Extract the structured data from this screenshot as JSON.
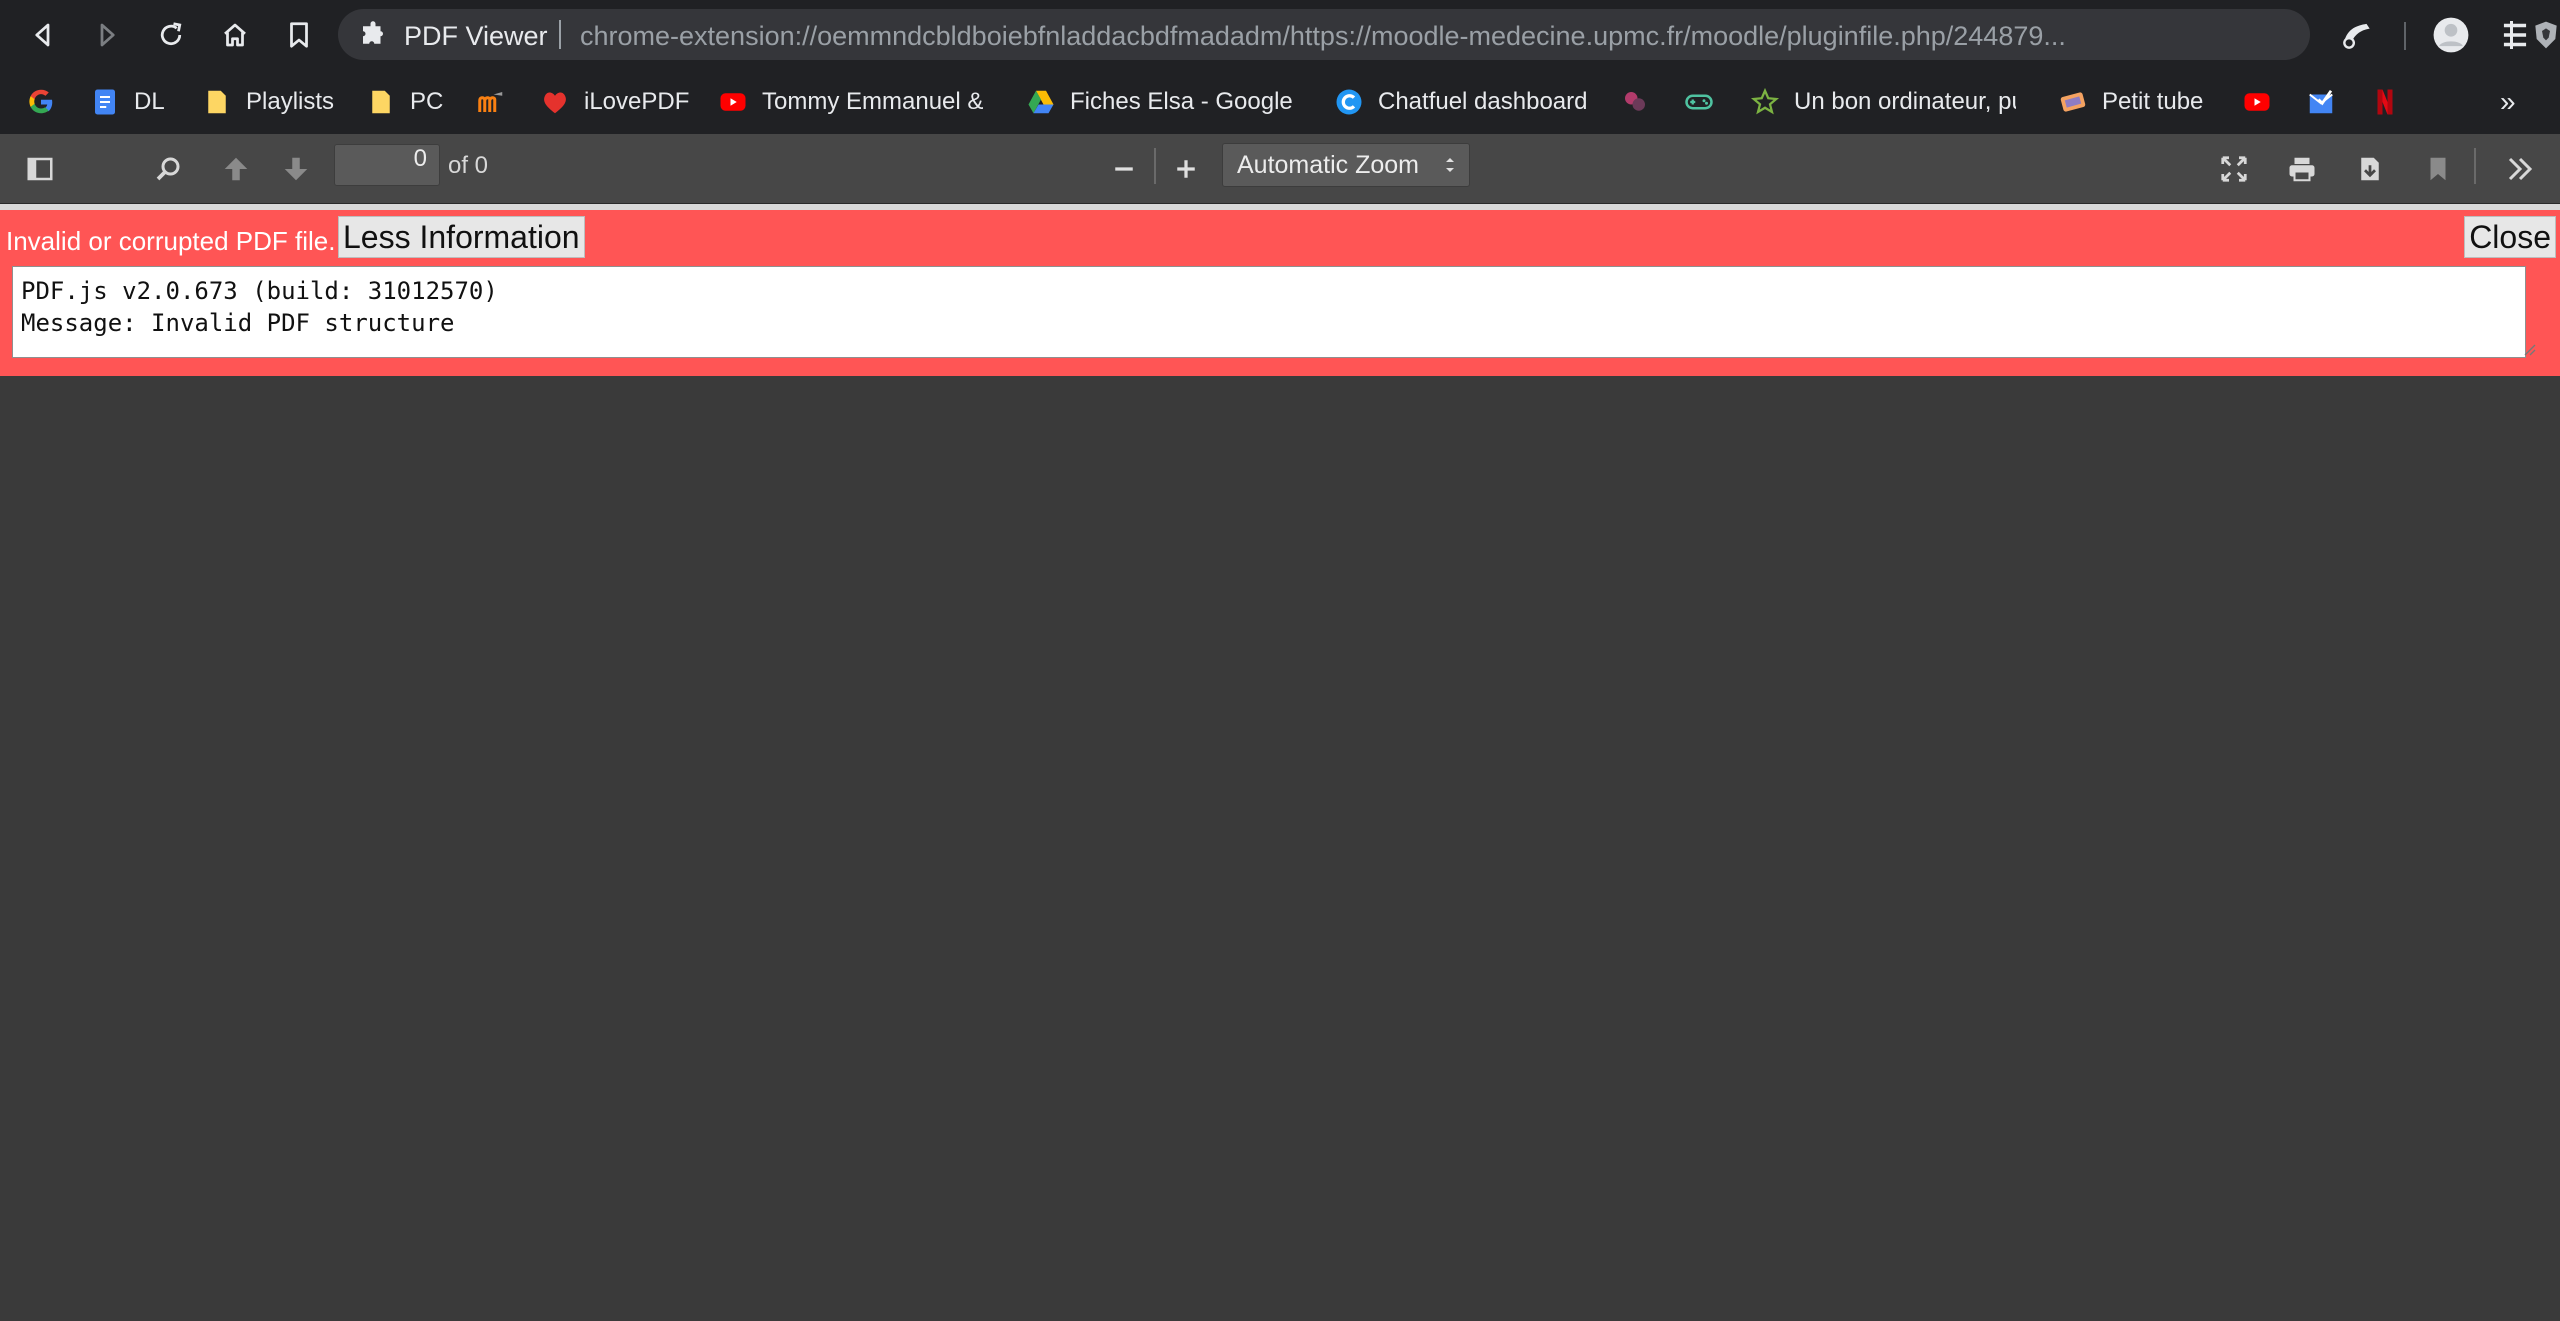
{
  "browser": {
    "omnibox": {
      "extension_name": "PDF Viewer",
      "url": "chrome-extension://oemmndcbldboiebfnladdacbdfmadadm/https://moodle-medecine.upmc.fr/moodle/pluginfile.php/244879..."
    },
    "nav_icons": [
      "back-icon",
      "forward-icon",
      "reload-icon",
      "home-icon",
      "bookmark-icon"
    ],
    "bookmarks": [
      {
        "label": "",
        "icon": "google-icon"
      },
      {
        "label": "DL",
        "icon": "docs-icon"
      },
      {
        "label": "Playlists",
        "icon": "folder-icon"
      },
      {
        "label": "PC",
        "icon": "folder-icon"
      },
      {
        "label": "",
        "icon": "moodle-icon"
      },
      {
        "label": "iLovePDF",
        "icon": "ilovepdf-icon"
      },
      {
        "label": "Tommy Emmanuel &",
        "icon": "youtube-icon"
      },
      {
        "label": "Fiches Elsa - Google D",
        "icon": "drive-icon"
      },
      {
        "label": "Chatfuel dashboard",
        "icon": "chatfuel-icon"
      },
      {
        "label": "",
        "icon": "puzzle-icon"
      },
      {
        "label": "",
        "icon": "gamepad-icon"
      },
      {
        "label": "Un bon ordinateur, pu",
        "icon": "star-icon"
      },
      {
        "label": "Petit tube",
        "icon": "petit-tube-icon"
      },
      {
        "label": "",
        "icon": "youtube-icon"
      },
      {
        "label": "",
        "icon": "inbox-icon"
      },
      {
        "label": "",
        "icon": "netflix-icon"
      }
    ],
    "bookmarks_overflow": "»"
  },
  "pdf_toolbar": {
    "page_number": "0",
    "page_count_label": "of 0",
    "zoom_selected": "Automatic Zoom"
  },
  "error": {
    "message": "Invalid or corrupted PDF file.",
    "less_info_label": "Less Information",
    "close_label": "Close",
    "details": "PDF.js v2.0.673 (build: 31012570)\nMessage: Invalid PDF structure"
  },
  "colors": {
    "error_bar": "#ff5555",
    "toolbar": "#474747",
    "viewer_bg": "#3a3a3a",
    "browser_chrome": "#202124"
  }
}
